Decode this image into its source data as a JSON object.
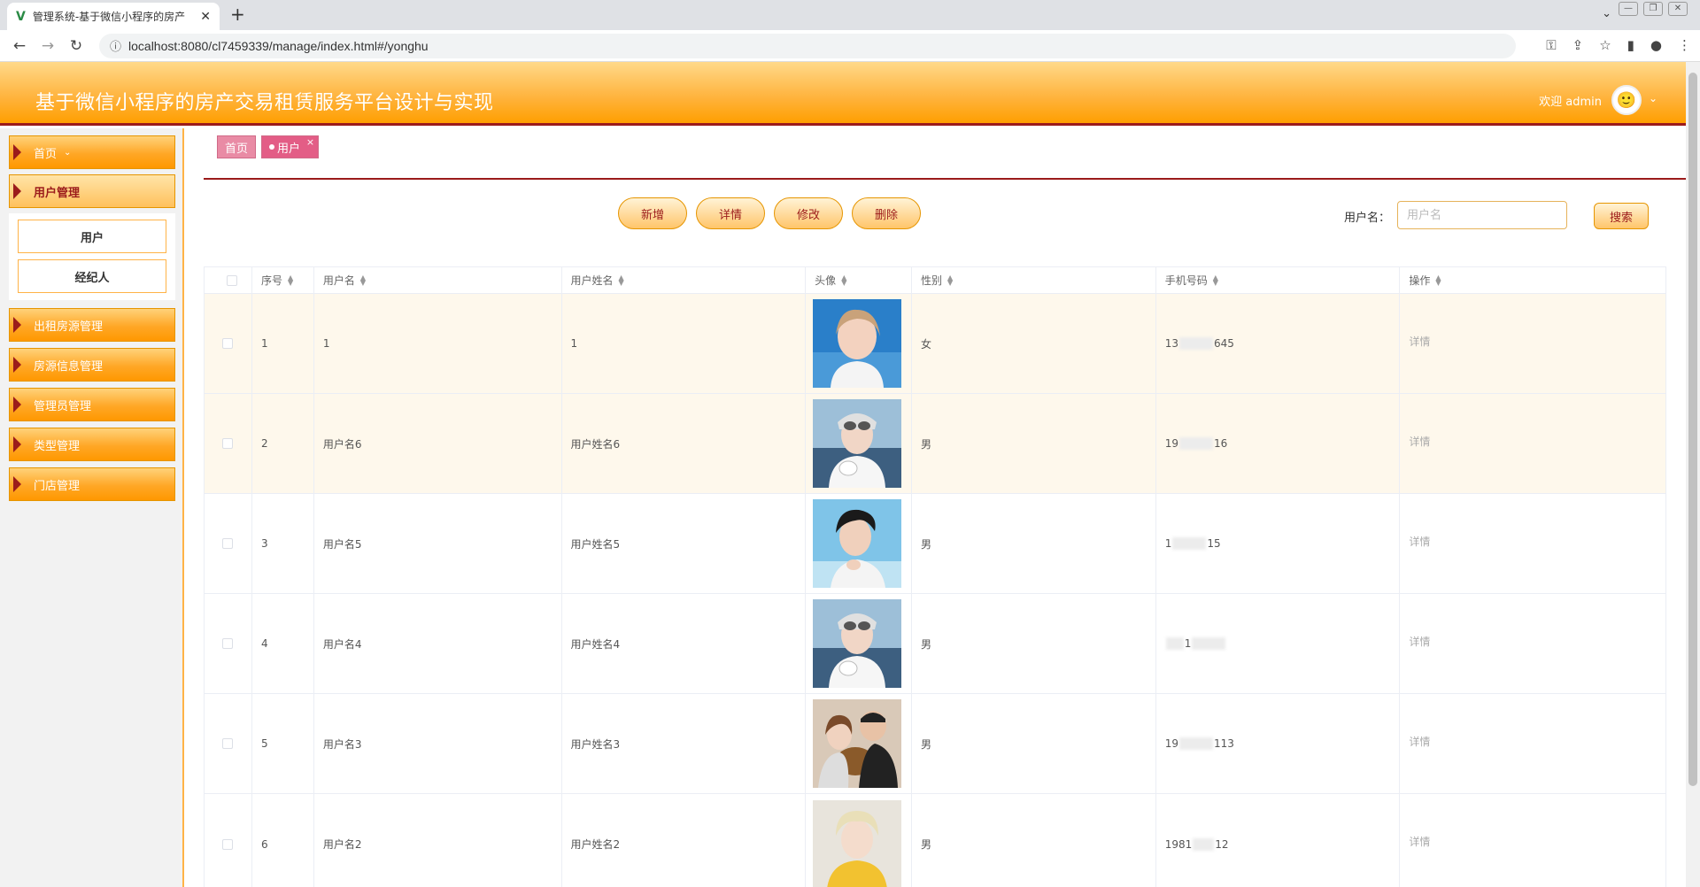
{
  "browser": {
    "tab_title": "管理系统-基于微信小程序的房产",
    "url": "localhost:8080/cl7459339/manage/index.html#/yonghu"
  },
  "header": {
    "title": "基于微信小程序的房产交易租赁服务平台设计与实现",
    "welcome": "欢迎 admin"
  },
  "sidebar": {
    "home": "首页",
    "user_mgmt": "用户管理",
    "sub_user": "用户",
    "sub_agent": "经纪人",
    "rental_mgmt": "出租房源管理",
    "house_info_mgmt": "房源信息管理",
    "admin_mgmt": "管理员管理",
    "type_mgmt": "类型管理",
    "store_mgmt": "门店管理"
  },
  "tags": {
    "home": "首页",
    "user": "用户"
  },
  "toolbar": {
    "add": "新增",
    "detail": "详情",
    "edit": "修改",
    "delete": "删除",
    "search_label": "用户名：",
    "search_placeholder": "用户名",
    "search_btn": "搜索"
  },
  "table": {
    "headers": [
      "序号",
      "用户名",
      "用户姓名",
      "头像",
      "性别",
      "手机号码",
      "操作"
    ],
    "rows": [
      {
        "idx": "1",
        "username": "1",
        "realname": "1",
        "gender": "女",
        "phone_a": "13",
        "phone_b": "645",
        "action": "详情"
      },
      {
        "idx": "2",
        "username": "用户名6",
        "realname": "用户姓名6",
        "gender": "男",
        "phone_a": "19",
        "phone_b": "16",
        "action": "详情"
      },
      {
        "idx": "3",
        "username": "用户名5",
        "realname": "用户姓名5",
        "gender": "男",
        "phone_a": "1",
        "phone_b": "15",
        "action": "详情"
      },
      {
        "idx": "4",
        "username": "用户名4",
        "realname": "用户姓名4",
        "gender": "男",
        "phone_a": "1",
        "phone_b": "",
        "action": "详情"
      },
      {
        "idx": "5",
        "username": "用户名3",
        "realname": "用户姓名3",
        "gender": "男",
        "phone_a": "19",
        "phone_b": "113",
        "action": "详情"
      },
      {
        "idx": "6",
        "username": "用户名2",
        "realname": "用户姓名2",
        "gender": "男",
        "phone_a": "1981",
        "phone_b": "12",
        "action": "详情"
      }
    ]
  },
  "colors": {
    "accent": "#ffa726",
    "dark_red": "#9b1b1b",
    "tag_pink": "#e35d86"
  }
}
